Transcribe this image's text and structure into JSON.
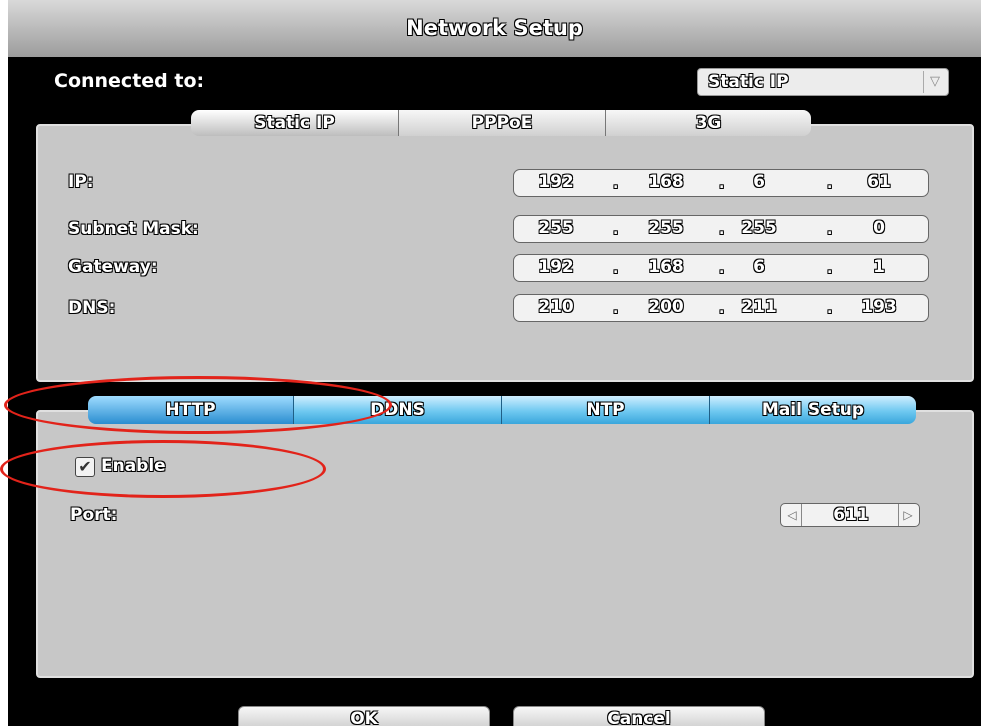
{
  "window": {
    "title": "Network Setup"
  },
  "connection": {
    "label": "Connected to:",
    "selected": "Static IP"
  },
  "top_tabs": [
    "Static IP",
    "PPPoE",
    "3G"
  ],
  "network": {
    "rows": [
      {
        "label": "IP:",
        "octets": [
          "192",
          "168",
          "6",
          "61"
        ]
      },
      {
        "label": "Subnet Mask:",
        "octets": [
          "255",
          "255",
          "255",
          "0"
        ]
      },
      {
        "label": "Gateway:",
        "octets": [
          "192",
          "168",
          "6",
          "1"
        ]
      },
      {
        "label": "DNS:",
        "octets": [
          "210",
          "200",
          "211",
          "193"
        ]
      }
    ],
    "separator": "."
  },
  "bottom_tabs": [
    "HTTP",
    "DDNS",
    "NTP",
    "Mail Setup"
  ],
  "http": {
    "enable_label": "Enable",
    "enabled": true,
    "port_label": "Port:",
    "port_value": "611"
  },
  "buttons": {
    "ok": "OK",
    "cancel": "Cancel"
  },
  "icons": {
    "dropdown": "chevron-down-icon",
    "checkbox": "check-icon",
    "spin_left": "triangle-left-icon",
    "spin_right": "triangle-right-icon"
  },
  "colors": {
    "annotation": "#e2231a",
    "tab_blue": "#3aa6dc",
    "panel": "#c7c7c7"
  }
}
